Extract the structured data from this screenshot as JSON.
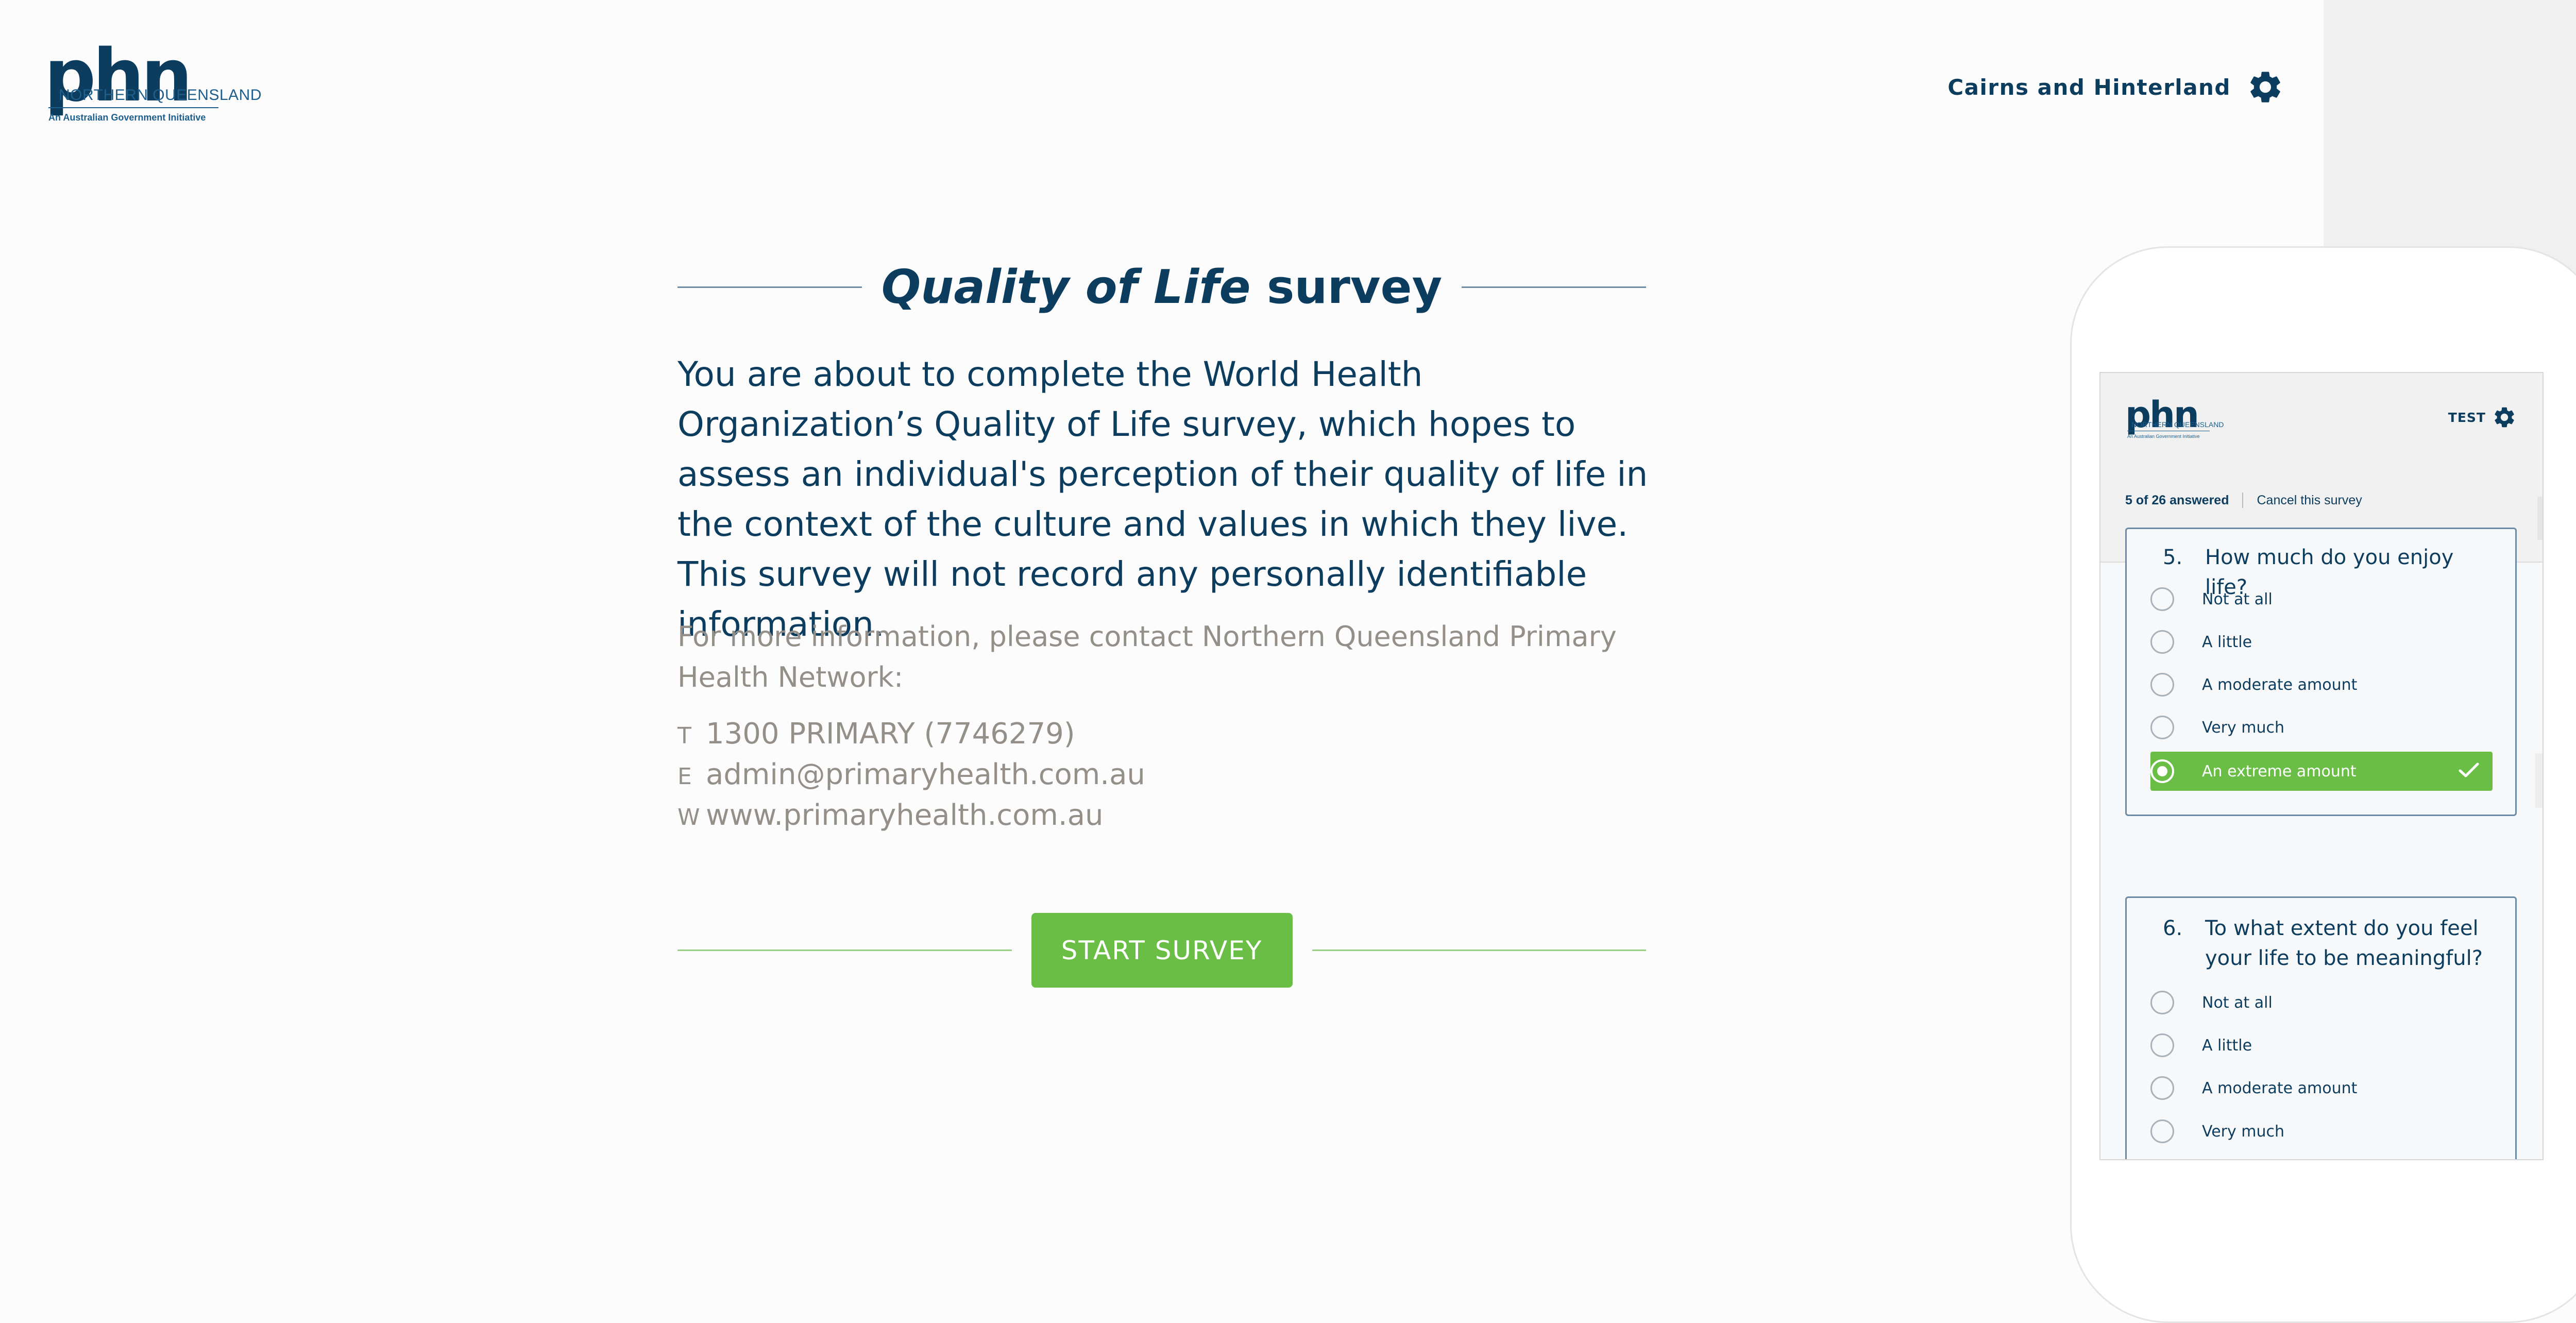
{
  "header": {
    "logo": {
      "main": "phn",
      "subtitle": "NORTHERN QUEENSLAND",
      "tagline": "An Australian Government Initiative"
    },
    "region": "Cairns and Hinterland",
    "settings_icon": "gear-icon"
  },
  "main": {
    "title_italic": "Quality of Life",
    "title_rest": " survey",
    "intro": "You are about to complete the World Health Organization’s Quality of Life survey, which hopes to assess an individual's perception of their quality of life in the context of the culture and values in which they live. This survey will not record any personally identifiable information.",
    "more_info": "For more information, please contact Northern Queensland Primary Health Network:",
    "contacts": [
      {
        "key": "T",
        "value": "1300 PRIMARY (7746279)"
      },
      {
        "key": "E",
        "value": "admin@primaryhealth.com.au"
      },
      {
        "key": "W",
        "value": "www.primaryhealth.com.au"
      }
    ],
    "start_button": "START SURVEY"
  },
  "mobile_preview": {
    "logo": {
      "main": "phn",
      "subtitle": "NORTHERN QUEENSLAND",
      "tagline": "An Australian Government Initiative"
    },
    "region": "TEST",
    "progress": {
      "answered_label": "5 of 26 answered",
      "cancel_label": "Cancel this survey",
      "fraction": 0.192
    },
    "questions": [
      {
        "number": "5.",
        "text": "How much do you enjoy life?",
        "options": [
          "Not at all",
          "A little",
          "A moderate amount",
          "Very much",
          "An extreme amount"
        ],
        "selected": "An extreme amount"
      },
      {
        "number": "6.",
        "text": "To what extent do you feel your life to be meaningful?",
        "options": [
          "Not at all",
          "A little",
          "A moderate amount",
          "Very much"
        ],
        "selected": null
      }
    ]
  },
  "colors": {
    "navy": "#0c3d5e",
    "green": "#6abe45",
    "muted": "#958f8a"
  }
}
